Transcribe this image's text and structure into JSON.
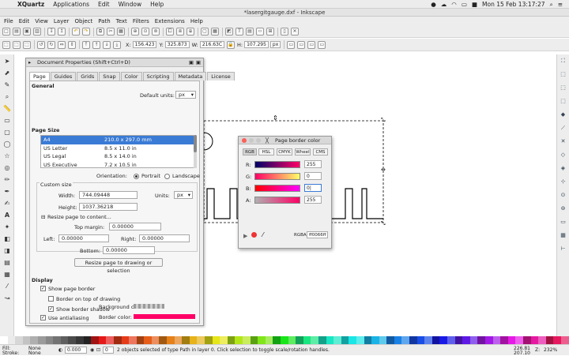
{
  "mac_menu": {
    "apple": "",
    "items": [
      "XQuartz",
      "Applications",
      "Edit",
      "Window",
      "Help"
    ],
    "clock": "Mon 15 Feb  13:17:27"
  },
  "window_title": "*lasergitgauge.dxf - Inkscape",
  "menubar": [
    "File",
    "Edit",
    "View",
    "Layer",
    "Object",
    "Path",
    "Text",
    "Filters",
    "Extensions",
    "Help"
  ],
  "toolbar2": {
    "x_label": "X:",
    "x": "156.423",
    "y_label": "Y:",
    "y": "325.873",
    "w_label": "W:",
    "w": "216.63C",
    "h_label": "H:",
    "h": "107.295",
    "unit": "px"
  },
  "doc_props": {
    "title": "Document Properties (Shift+Ctrl+D)",
    "tabs": [
      "Page",
      "Guides",
      "Grids",
      "Snap",
      "Color",
      "Scripting",
      "Metadata",
      "License"
    ],
    "general": "General",
    "default_units_label": "Default units:",
    "default_units": "px",
    "page_size": "Page Size",
    "sizes": [
      [
        "A4",
        "210.0 x 297.0 mm"
      ],
      [
        "US Letter",
        "8.5 x 11.0 in"
      ],
      [
        "US Legal",
        "8.5 x 14.0 in"
      ],
      [
        "US Executive",
        "7.2 x 10.5 in"
      ]
    ],
    "orientation_label": "Orientation:",
    "portrait": "Portrait",
    "landscape": "Landscape",
    "custom_size": "Custom size",
    "width_label": "Width:",
    "width": "744.09448",
    "height_label": "Height:",
    "height": "1037.36218",
    "units_label": "Units:",
    "units": "px",
    "resize_label": "Resize page to content...",
    "top_margin_label": "Top margin:",
    "top_margin": "0.00000",
    "left_label": "Left:",
    "left": "0.00000",
    "right_label": "Right:",
    "right": "0.00000",
    "bottom_label": "Bottom:",
    "bottom": "0.00000",
    "resize_button": "Resize page to drawing or selection",
    "display": "Display",
    "show_border": "Show page border",
    "border_on_top": "Border on top of drawing",
    "show_shadow": "Show border shadow",
    "antialias": "Use antialiasing",
    "bg_color_label": "Background color:",
    "border_color_label": "Border color:",
    "border_color": "#ff0066"
  },
  "page_border_color": {
    "title": "Page border color",
    "tabs": [
      "RGB",
      "HSL",
      "CMYK",
      "Wheel",
      "CMS"
    ],
    "channels": [
      {
        "label": "R:",
        "value": "255"
      },
      {
        "label": "G:",
        "value": "0"
      },
      {
        "label": "B:",
        "value": "0|"
      },
      {
        "label": "A:",
        "value": "255"
      }
    ],
    "rgba_label": "RGBA:",
    "rgba": "ff0066ff"
  },
  "status": {
    "fill_label": "Fill:",
    "stroke_label": "Stroke:",
    "fill_value": "None",
    "stroke_value": "None",
    "opacity": "0.000",
    "layer": "0",
    "message": "2 objects selected of type Path in layer 0. Click selection to toggle scale/rotation handles.",
    "x": "226.81",
    "y": "207.10",
    "z_label": "Z:",
    "zoom": "232%"
  }
}
